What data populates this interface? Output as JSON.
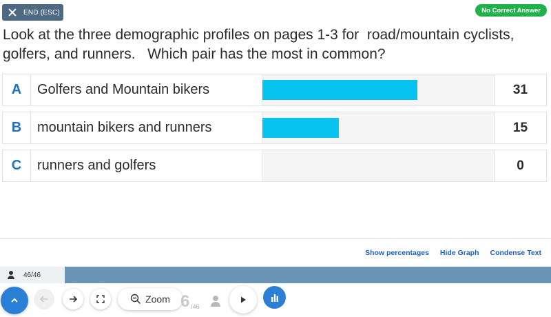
{
  "header": {
    "end_label": "END (ESC)",
    "status_badge": "No Correct Answer",
    "status_color": "#1fb14a"
  },
  "question": {
    "text": "Look at the three demographic profiles on pages 1-3 for  road/mountain cyclists,\ngolfers, and runners.   Which pair has the most in common?"
  },
  "answers": [
    {
      "letter": "A",
      "text": "Golfers and Mountain bikers",
      "count": "31",
      "bar_fraction": 0.67
    },
    {
      "letter": "B",
      "text": "mountain bikers and runners",
      "count": "15",
      "bar_fraction": 0.33
    },
    {
      "letter": "C",
      "text": "runners and golfers",
      "count": "0",
      "bar_fraction": 0.0
    }
  ],
  "bar_color": "#08c3f0",
  "footer_links": {
    "show_percentages": "Show percentages",
    "hide_graph": "Hide Graph",
    "condense_text": "Condense Text"
  },
  "progress": {
    "responses": "46/46"
  },
  "toolbar": {
    "zoom_label": "Zoom",
    "page_number": "6",
    "page_total": "/46",
    "icons": [
      "chevron-up-icon",
      "arrow-left-icon",
      "arrow-right-icon",
      "fullscreen-icon",
      "zoom-out-icon",
      "user-icon",
      "play-icon",
      "bar-chart-icon"
    ]
  }
}
